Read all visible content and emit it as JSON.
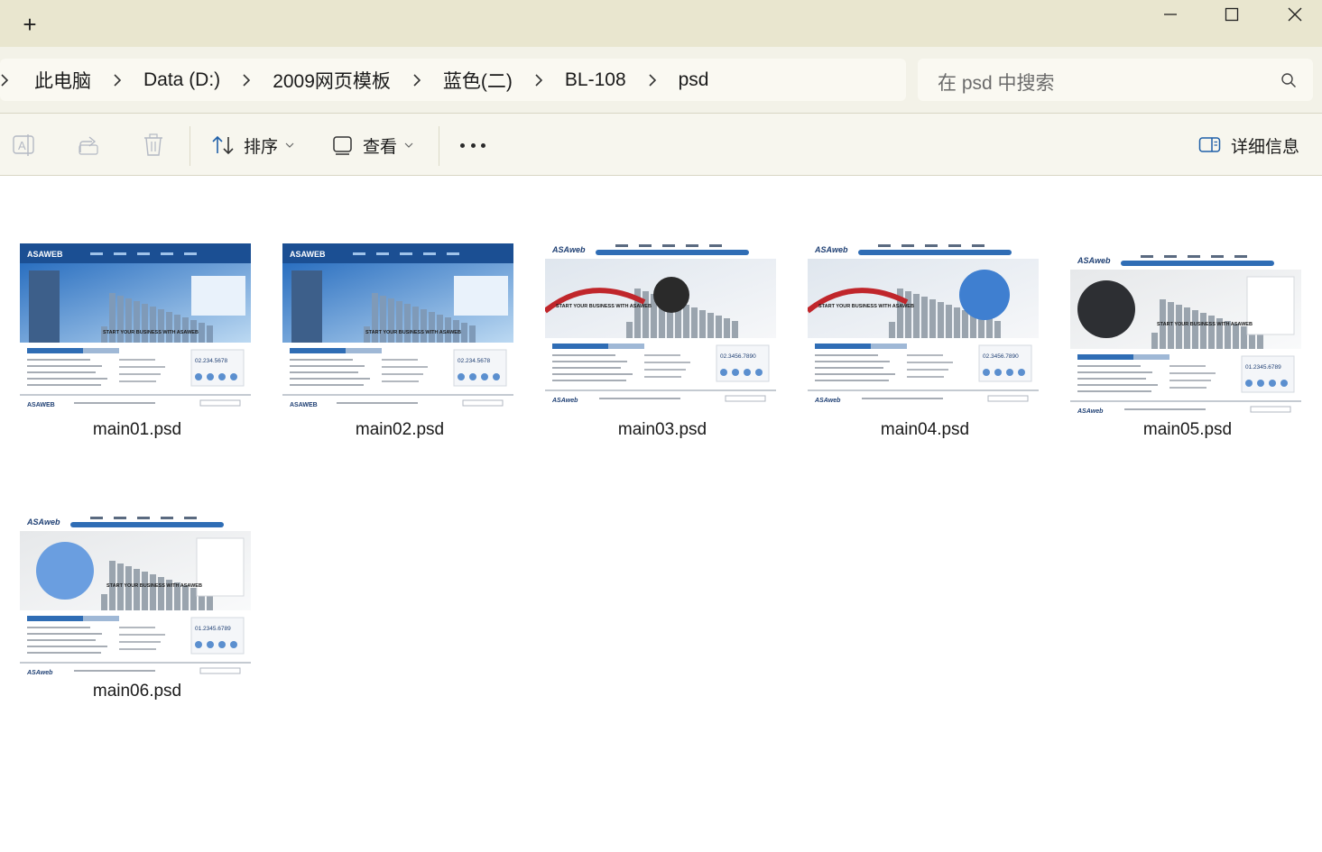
{
  "window": {
    "new_tab": "+",
    "controls": [
      "minimize-icon",
      "maximize-icon",
      "close-icon"
    ]
  },
  "address": {
    "breadcrumb": [
      "此电脑",
      "Data (D:)",
      "2009网页模板",
      "蓝色(二)",
      "BL-108",
      "psd"
    ],
    "search_placeholder": "在 psd 中搜索"
  },
  "toolbar": {
    "sort_label": "排序",
    "view_label": "查看",
    "details_label": "详细信息"
  },
  "files": [
    {
      "name": "main01.psd",
      "brand": "ASAWEB",
      "banner": "START YOUR BUSINESS WITH ASAWEB",
      "phone": "02.234.5678",
      "style": "dark"
    },
    {
      "name": "main02.psd",
      "brand": "ASAWEB",
      "banner": "START YOUR BUSINESS WITH ASAWEB",
      "phone": "02.234.5678",
      "style": "dark"
    },
    {
      "name": "main03.psd",
      "brand": "ASAweb",
      "banner": "START YOUR BUSINESS WITH ASAWEB",
      "phone": "02.3456.7890",
      "style": "light"
    },
    {
      "name": "main04.psd",
      "brand": "ASAweb",
      "banner": "START YOUR BUSINESS WITH ASAWEB",
      "phone": "02.3456.7890",
      "style": "light"
    },
    {
      "name": "main05.psd",
      "brand": "ASAweb",
      "banner": "START YOUR BUSINESS WITH ASAWEB",
      "phone": "01.2345.6789",
      "style": "grey"
    },
    {
      "name": "main06.psd",
      "brand": "ASAweb",
      "banner": "START YOUR BUSINESS WITH ASAWEB",
      "phone": "01.2345.6789",
      "style": "grey"
    }
  ],
  "colors": {
    "titlebar": "#e9e6cf",
    "addressbar": "#f3f2e8",
    "accent_blue": "#1f5fa8"
  }
}
